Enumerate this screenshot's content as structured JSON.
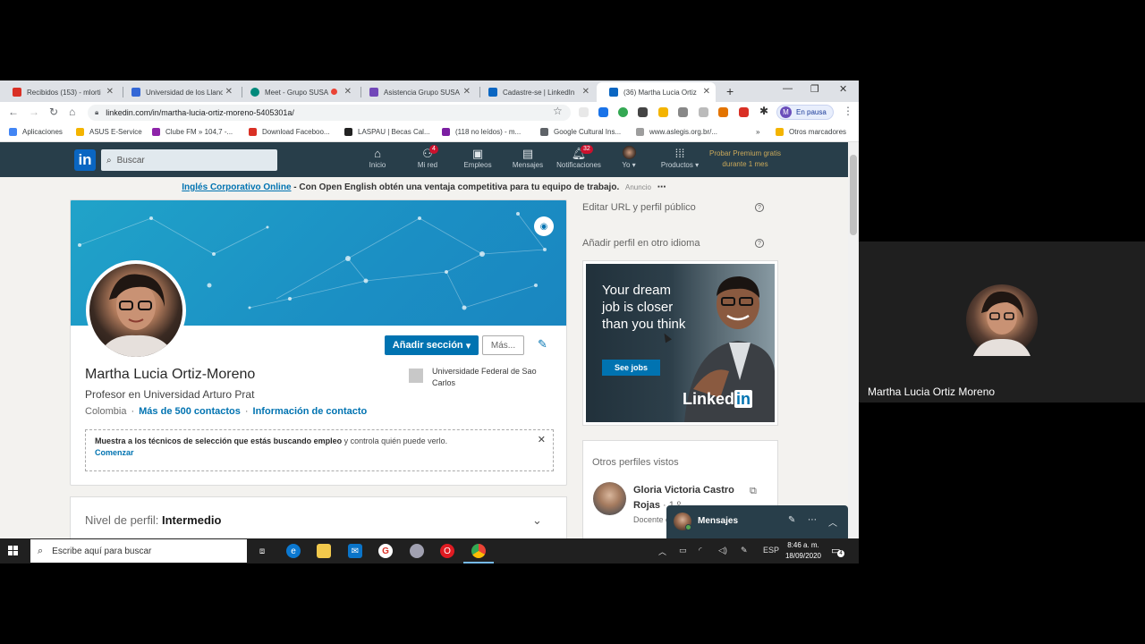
{
  "browser": {
    "tabs": [
      {
        "label": "Recibidos (153) - mlorti",
        "color": "#d93025"
      },
      {
        "label": "Universidad de los Llano",
        "color": "#3367d6"
      },
      {
        "label": "Meet - Grupo SUSA",
        "color": "#00897b"
      },
      {
        "label": "Asistencia Grupo SUSA",
        "color": "#7248b9"
      },
      {
        "label": "Cadastre-se | LinkedIn",
        "color": "#0a66c2"
      },
      {
        "label": "(36) Martha Lucia Ortiz",
        "color": "#0a66c2"
      }
    ],
    "url": "linkedin.com/in/martha-lucia-ortiz-moreno-5405301a/",
    "profile_status": "En pausa",
    "profile_initial": "M",
    "bookmarks": [
      "Aplicaciones",
      "ASUS E-Service",
      "Clube FM » 104,7 -...",
      "Download Faceboo...",
      "LASPAU | Becas Cal...",
      "(118 no leídos) - m...",
      "Google Cultural Ins...",
      "www.aslegis.org.br/...",
      "Otros marcadores"
    ]
  },
  "linkedin": {
    "logo": "in",
    "search_placeholder": "Buscar",
    "nav": [
      {
        "label": "Inicio",
        "icon": "home-icon",
        "badge": ""
      },
      {
        "label": "Mi red",
        "icon": "network-icon",
        "badge": "4"
      },
      {
        "label": "Empleos",
        "icon": "briefcase-icon",
        "badge": ""
      },
      {
        "label": "Mensajes",
        "icon": "messages-icon",
        "badge": ""
      },
      {
        "label": "Notificaciones",
        "icon": "bell-icon",
        "badge": "32"
      },
      {
        "label": "Yo",
        "icon": "avatar-icon",
        "badge": ""
      },
      {
        "label": "Productos",
        "icon": "grid-icon",
        "badge": ""
      }
    ],
    "premium_line1": "Probar Premium gratis",
    "premium_line2": "durante 1 mes",
    "ad_banner": {
      "link": "Inglés Corporativo Online",
      "text": " - Con Open English obtén una ventaja competitiva para tu equipo de trabajo.",
      "tag": "Anuncio"
    },
    "profile": {
      "add_section": "Añadir sección",
      "more": "Más...",
      "name": "Martha Lucia Ortiz-Moreno",
      "headline": "Profesor en Universidad Arturo Prat",
      "location": "Colombia",
      "contacts": "Más de 500 contactos",
      "contact_info": "Información de contacto",
      "education": "Universidade Federal de Sao Carlos",
      "open_bold": "Muestra a los técnicos de selección que estás buscando empleo",
      "open_rest": " y controla quién puede verlo.",
      "open_link": "Comenzar"
    },
    "level_label": "Nivel de perfil: ",
    "level_value": "Intermedio",
    "right": {
      "edit_url": "Editar URL y perfil público",
      "add_language": "Añadir perfil en otro idioma",
      "ad_headline": "Your dream job is closer than you think",
      "ad_button": "See jobs",
      "ad_brand_a": "Linked",
      "ad_brand_b": "in",
      "others_title": "Otros perfiles vistos",
      "other_name": "Gloria Victoria Castro Rojas",
      "other_degree": "· 1.º",
      "other_sub": "Docente de los Ll..."
    },
    "messages_label": "Mensajes"
  },
  "taskbar": {
    "search_placeholder": "Escribe aquí para buscar",
    "language": "ESP",
    "time": "8:46 a. m.",
    "date": "18/09/2020",
    "notif_count": "4"
  },
  "video": {
    "participant_name": "Martha Lucia Ortiz Moreno"
  }
}
